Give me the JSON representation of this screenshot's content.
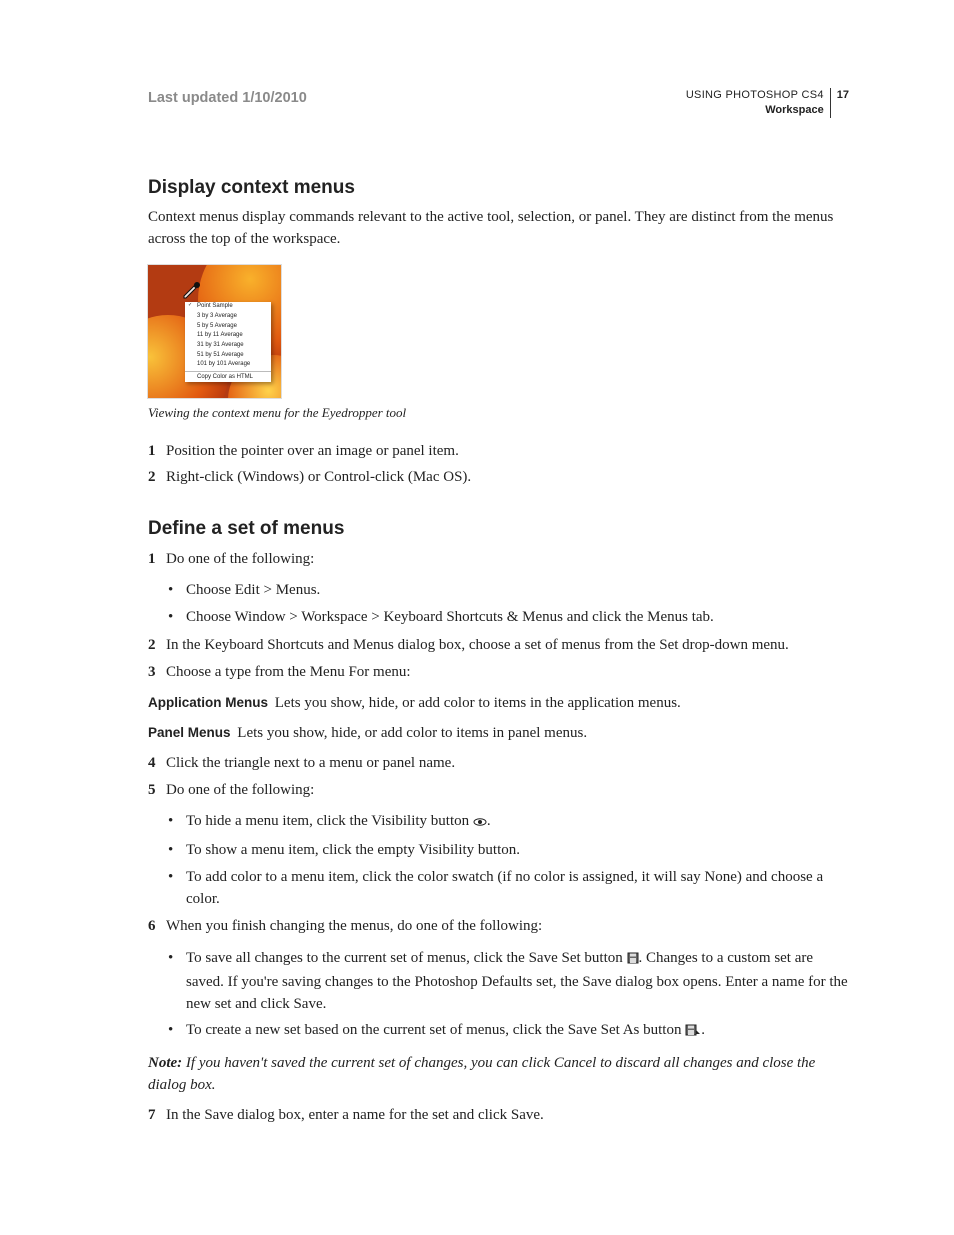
{
  "header": {
    "last_updated": "Last updated 1/10/2010",
    "title": "USING PHOTOSHOP CS4",
    "section": "Workspace",
    "page": "17"
  },
  "sections": {
    "display": {
      "heading": "Display context menus",
      "intro": "Context menus display commands relevant to the active tool, selection, or panel. They are distinct from the menus across the top of the workspace.",
      "caption": "Viewing the context menu for the Eyedropper tool",
      "menu_items": {
        "m0": "Point Sample",
        "m1": "3 by 3 Average",
        "m2": "5 by 5 Average",
        "m3": "11 by 11 Average",
        "m4": "31 by 31 Average",
        "m5": "51 by 51 Average",
        "m6": "101 by 101 Average",
        "m7": "Copy Color as HTML"
      },
      "steps": {
        "s1": "Position the pointer over an image or panel item.",
        "s2": "Right-click (Windows) or Control-click (Mac OS)."
      }
    },
    "define": {
      "heading": "Define a set of menus",
      "steps": {
        "s1": "Do one of the following:",
        "s1b1": "Choose Edit > Menus.",
        "s1b2": "Choose Window > Workspace > Keyboard Shortcuts & Menus and click the Menus tab.",
        "s2": "In the Keyboard Shortcuts and Menus dialog box, choose a set of menus from the Set drop-down menu.",
        "s3": "Choose a type from the Menu For menu:",
        "appmenus_term": "Application Menus",
        "appmenus_desc": "Lets you show, hide, or add color to items in the application menus.",
        "panelmenus_term": "Panel Menus",
        "panelmenus_desc": "Lets you show, hide, or add color to items in panel menus.",
        "s4": "Click the triangle next to a menu or panel name.",
        "s5": "Do one of the following:",
        "s5b1a": "To hide a menu item, click the Visibility button ",
        "s5b1b": ".",
        "s5b2": "To show a menu item, click the empty Visibility button.",
        "s5b3": "To add color to a menu item, click the color swatch (if no color is assigned, it will say None) and choose a color.",
        "s6": "When you finish changing the menus, do one of the following:",
        "s6b1a": "To save all changes to the current set of menus, click the Save Set button ",
        "s6b1b": ". Changes to a custom set are saved. If you're saving changes to the Photoshop Defaults set, the Save dialog box opens. Enter a name for the new set and click Save.",
        "s6b2a": "To create a new set based on the current set of menus, click the Save Set As button ",
        "s6b2b": ".",
        "note_label": "Note:",
        "note": " If you haven't saved the current set of changes, you can click Cancel to discard all changes and close the dialog box.",
        "s7": "In the Save dialog box, enter a name for the set and click Save."
      }
    }
  }
}
